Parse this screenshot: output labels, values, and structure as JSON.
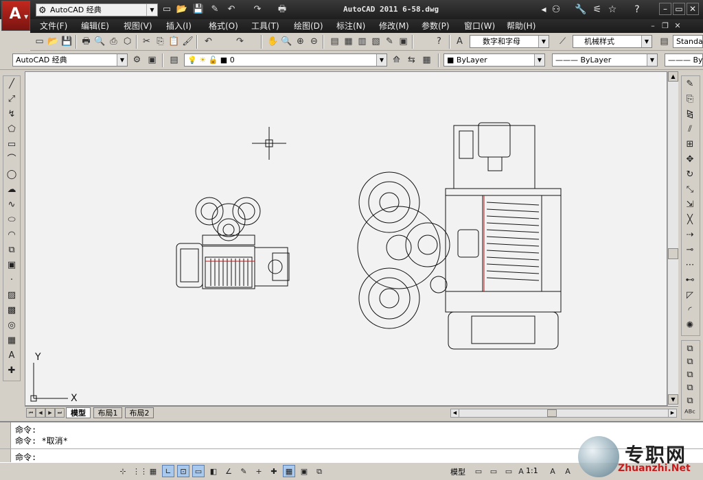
{
  "window": {
    "title": "AutoCAD 2011     6-58.dwg",
    "workspace": "AutoCAD 经典"
  },
  "menu": [
    "文件(F)",
    "编辑(E)",
    "视图(V)",
    "插入(I)",
    "格式(O)",
    "工具(T)",
    "绘图(D)",
    "标注(N)",
    "修改(M)",
    "参数(P)",
    "窗口(W)",
    "帮助(H)"
  ],
  "toolbar2": {
    "text_style": "数字和字母",
    "dim_style": "机械样式",
    "table_style": "Standard"
  },
  "toolbar3": {
    "workspace_combo": "AutoCAD 经典",
    "layer_value": "0",
    "color_combo": "ByLayer",
    "linetype_combo": "ByLayer",
    "lineweight_combo": "ByLayer"
  },
  "canvas": {
    "ucs_y": "Y",
    "ucs_x": "X"
  },
  "tabs": [
    "模型",
    "布局1",
    "布局2"
  ],
  "command": {
    "history": [
      "命令:",
      "命令: *取消*"
    ],
    "prompt": "命令:"
  },
  "status": {
    "model_label": "模型",
    "scale": "1:1"
  },
  "watermark": {
    "cn": "专职网",
    "en": "Zhuanzhi.Net"
  },
  "icons": {
    "side_left": [
      "line-icon",
      "construction-line-icon",
      "polyline-icon",
      "polygon-icon",
      "rectangle-icon",
      "arc-icon",
      "circle-icon",
      "revision-cloud-icon",
      "spline-icon",
      "ellipse-icon",
      "ellipse-arc-icon",
      "insert-block-icon",
      "make-block-icon",
      "point-icon",
      "hatch-icon",
      "gradient-icon",
      "region-icon",
      "table-icon",
      "multiline-text-icon",
      "add-selected-icon"
    ],
    "side_right": [
      "erase-icon",
      "copy-icon",
      "mirror-icon",
      "offset-icon",
      "array-icon",
      "move-icon",
      "rotate-icon",
      "scale-icon",
      "stretch-icon",
      "trim-icon",
      "extend-icon",
      "break-at-point-icon",
      "break-icon",
      "join-icon",
      "chamfer-icon",
      "fillet-icon",
      "explode-icon"
    ],
    "side_right2": [
      "draworder-front-icon",
      "draworder-back-icon",
      "draworder-above-icon",
      "draworder-under-icon",
      "draworder-text-icon",
      "spell-check-icon"
    ]
  }
}
